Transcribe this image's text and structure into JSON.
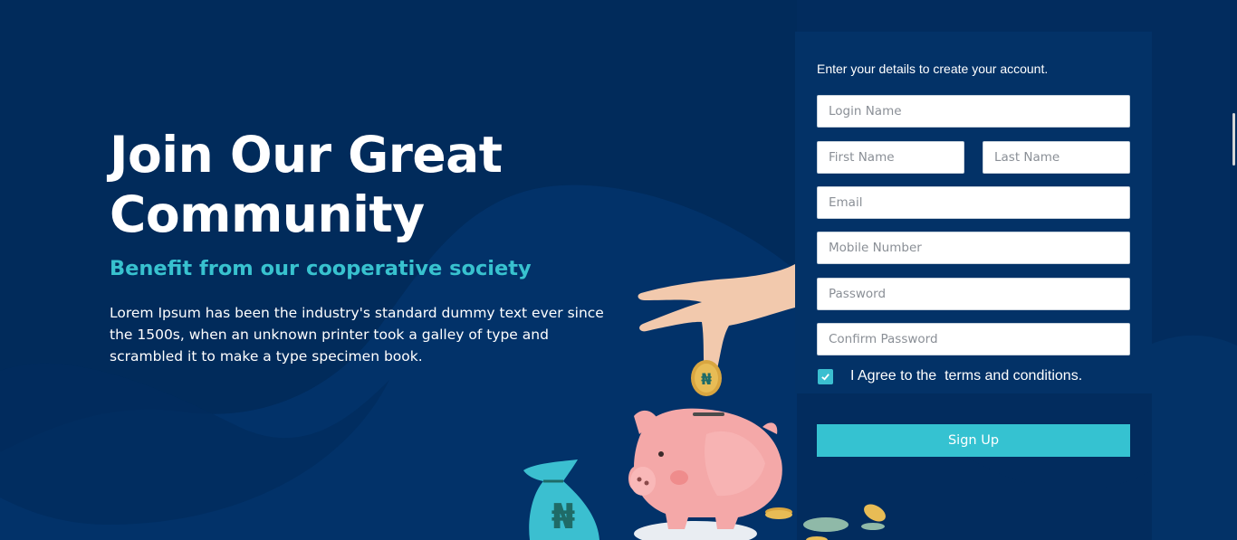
{
  "hero": {
    "title": "Join Our Great Community",
    "subtitle": "Benefit from our cooperative society",
    "description": "Lorem Ipsum has been the industry's standard dummy text ever since the 1500s, when an unknown printer took a galley of type and scrambled it to make a type specimen book."
  },
  "form": {
    "intro": "Enter your details to create your account.",
    "login_name": {
      "placeholder": "Login Name",
      "value": ""
    },
    "first_name": {
      "placeholder": "First Name",
      "value": ""
    },
    "last_name": {
      "placeholder": "Last Name",
      "value": ""
    },
    "email": {
      "placeholder": "Email",
      "value": ""
    },
    "mobile": {
      "placeholder": "Mobile Number",
      "value": ""
    },
    "password": {
      "placeholder": "Password",
      "value": ""
    },
    "confirm_password": {
      "placeholder": "Confirm Password",
      "value": ""
    },
    "agree_checked": true,
    "agree_text": "I Agree to the  terms and conditions.",
    "submit_label": "Sign Up"
  },
  "illustration": {
    "coin_symbol": "₦",
    "bag_symbol": "₦"
  },
  "colors": {
    "background": "#022c5e",
    "card": "#033267",
    "accent": "#35c2d1"
  }
}
